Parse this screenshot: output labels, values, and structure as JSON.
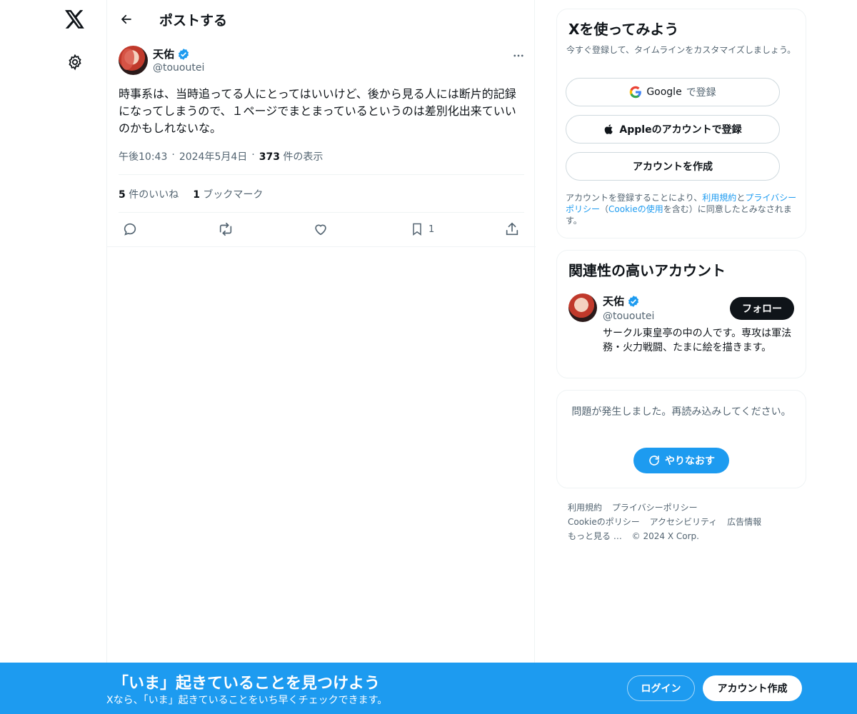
{
  "nav": {
    "logo_icon": "x-logo-icon",
    "settings_icon": "gear-icon"
  },
  "header": {
    "title": "ポストする",
    "back_icon": "arrow-left-icon"
  },
  "post": {
    "author_name": "天佑",
    "author_handle": "@tououtei",
    "text": "時事系は、当時追ってる人にとってはいいけど、後から見る人には断片的記録になってしまうので、１ページでまとまっているというのは差別化出来ていいのかもしれないな。",
    "time": "午後10:43",
    "sep": "·",
    "date": "2024年5月4日",
    "views_count": "373",
    "views_label": "件の表示",
    "likes_count": "5",
    "likes_label": "件のいいね",
    "bookmarks_count": "1",
    "bookmarks_label": "ブックマーク",
    "bookmark_action_count": "1"
  },
  "signup": {
    "title": "Xを使ってみよう",
    "subtitle": "今すぐ登録して、タイムラインをカスタマイズしましょう。",
    "google_brand": "Google",
    "google_suffix": "で登録",
    "apple_label": "Appleのアカウントで登録",
    "create_label": "アカウントを作成",
    "legal_pre": "アカウントを登録することにより、",
    "legal_terms": "利用規約",
    "legal_and": "と",
    "legal_privacy": "プライバシーポリシー",
    "legal_open": "（",
    "legal_cookie": "Cookieの使用",
    "legal_post": "を含む）に同意したとみなされます。"
  },
  "related": {
    "title": "関連性の高いアカウント",
    "name": "天佑",
    "handle": "@tououtei",
    "follow_label": "フォロー",
    "bio": "サークル東皇亭の中の人です。専攻は軍法務・火力戦闘、たまに絵を描きます。"
  },
  "error": {
    "message": "問題が発生しました。再読み込みしてください。",
    "retry_label": "やりなおす"
  },
  "footer": {
    "links": [
      "利用規約",
      "プライバシーポリシー",
      "Cookieのポリシー",
      "アクセシビリティ",
      "広告情報",
      "もっと見る …",
      "© 2024 X Corp."
    ]
  },
  "banner": {
    "title": "「いま」起きていることを見つけよう",
    "subtitle": "Xなら、「いま」起きていることをいち早くチェックできます。",
    "login_label": "ログイン",
    "create_label": "アカウント作成"
  },
  "colors": {
    "accent": "#1d9bf0",
    "text": "#0f1419",
    "muted": "#536471",
    "border": "#eff3f4"
  }
}
